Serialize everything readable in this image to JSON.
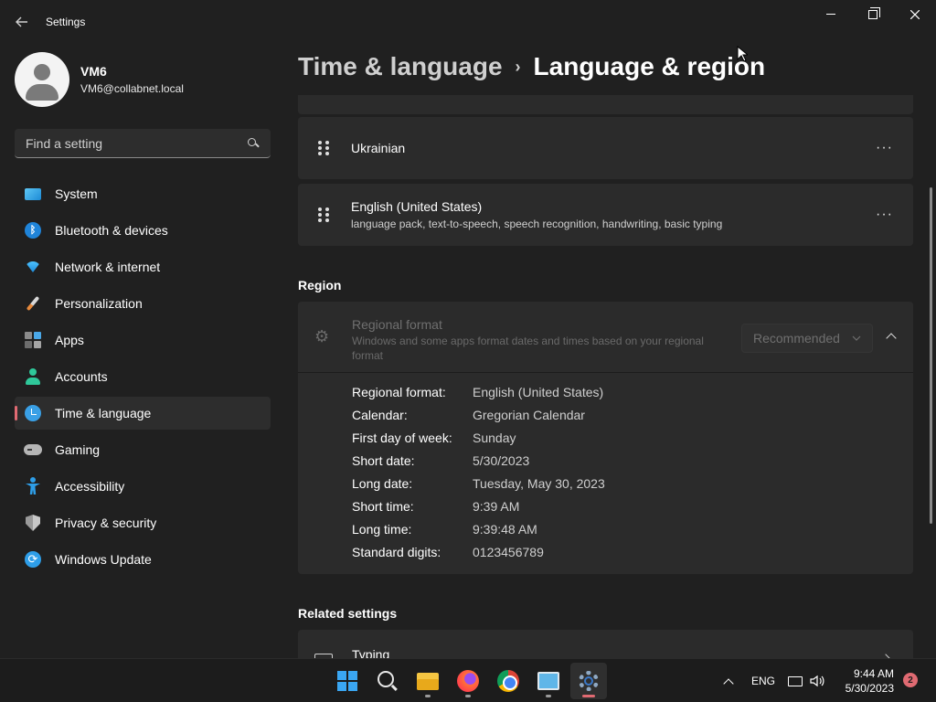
{
  "window": {
    "title": "Settings",
    "back_icon": "back-arrow-icon",
    "controls": {
      "minimize": "—",
      "close": "✕"
    }
  },
  "profile": {
    "name": "VM6",
    "email": "VM6@collabnet.local"
  },
  "search": {
    "placeholder": "Find a setting",
    "icon": "search-icon"
  },
  "sidebar": {
    "active": "Time & language",
    "items": [
      {
        "label": "System",
        "icon": "system-icon"
      },
      {
        "label": "Bluetooth & devices",
        "icon": "bluetooth-icon"
      },
      {
        "label": "Network & internet",
        "icon": "wifi-icon"
      },
      {
        "label": "Personalization",
        "icon": "brush-icon"
      },
      {
        "label": "Apps",
        "icon": "apps-icon"
      },
      {
        "label": "Accounts",
        "icon": "accounts-icon"
      },
      {
        "label": "Time & language",
        "icon": "time-language-icon"
      },
      {
        "label": "Gaming",
        "icon": "gaming-icon"
      },
      {
        "label": "Accessibility",
        "icon": "accessibility-icon"
      },
      {
        "label": "Privacy & security",
        "icon": "shield-icon"
      },
      {
        "label": "Windows Update",
        "icon": "update-icon"
      }
    ]
  },
  "header": {
    "parent": "Time & language",
    "separator": "›",
    "current": "Language & region"
  },
  "languages": [
    {
      "name": "Ukrainian",
      "subtitle": ""
    },
    {
      "name": "English (United States)",
      "subtitle": "language pack, text-to-speech, speech recognition, handwriting, basic typing"
    }
  ],
  "more_label": "···",
  "region": {
    "section_title": "Region",
    "format_title": "Regional format",
    "format_desc": "Windows and some apps format dates and times based on your regional format",
    "select_value": "Recommended",
    "rows": [
      {
        "label": "Regional format:",
        "value": "English (United States)"
      },
      {
        "label": "Calendar:",
        "value": "Gregorian Calendar"
      },
      {
        "label": "First day of week:",
        "value": "Sunday"
      },
      {
        "label": "Short date:",
        "value": "5/30/2023"
      },
      {
        "label": "Long date:",
        "value": "Tuesday, May 30, 2023"
      },
      {
        "label": "Short time:",
        "value": "9:39 AM"
      },
      {
        "label": "Long time:",
        "value": "9:39:48 AM"
      },
      {
        "label": "Standard digits:",
        "value": "0123456789"
      }
    ]
  },
  "related": {
    "section_title": "Related settings",
    "typing_label": "Typing"
  },
  "taskbar": {
    "apps": [
      "start-icon",
      "search-icon",
      "file-explorer-icon",
      "firefox-icon",
      "chrome-icon",
      "remote-desktop-icon",
      "settings-icon"
    ],
    "active_app": "settings-icon",
    "tray": {
      "language": "ENG",
      "time": "9:44 AM",
      "date": "5/30/2023",
      "notification_count": "2"
    }
  },
  "colors": {
    "background": "#202020",
    "card": "#2b2b2b",
    "accent": "#e06a72",
    "taskbar": "#1c1c1c"
  }
}
